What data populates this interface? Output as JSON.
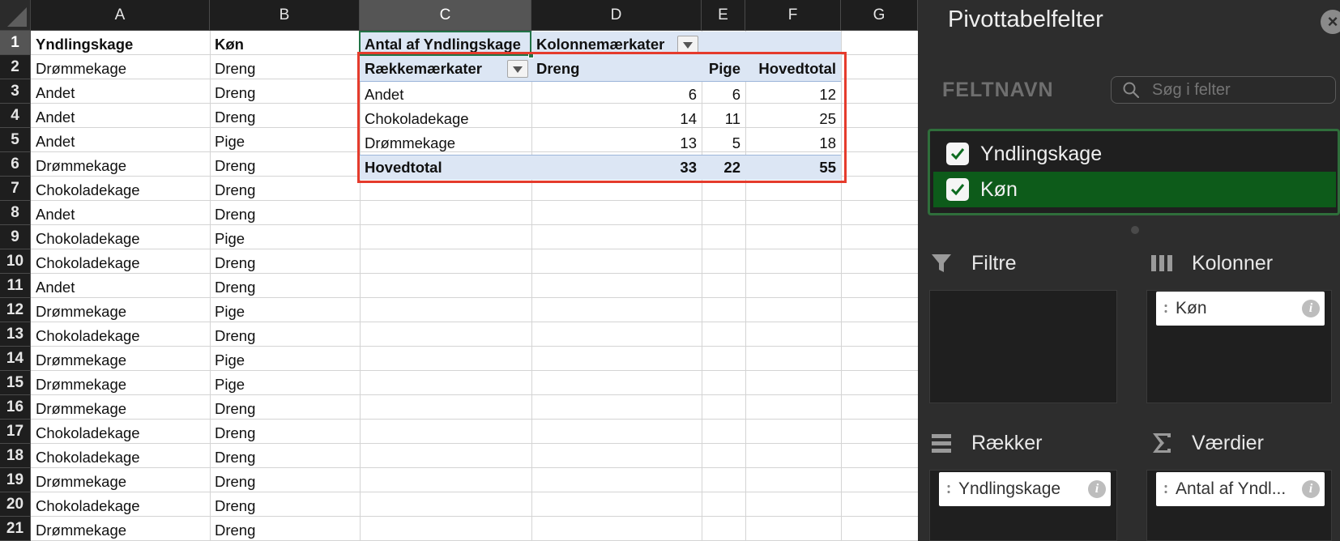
{
  "columns": [
    "A",
    "B",
    "C",
    "D",
    "E",
    "F",
    "G"
  ],
  "rows": [
    "1",
    "2",
    "3",
    "4",
    "5",
    "6",
    "7",
    "8",
    "9",
    "10",
    "11",
    "12",
    "13",
    "14",
    "15",
    "16",
    "17",
    "18",
    "19",
    "20",
    "21"
  ],
  "source": {
    "header_a": "Yndlingskage",
    "header_b": "Køn",
    "data": [
      [
        "Drømmekage",
        "Dreng"
      ],
      [
        "Andet",
        "Dreng"
      ],
      [
        "Andet",
        "Dreng"
      ],
      [
        "Andet",
        "Pige"
      ],
      [
        "Drømmekage",
        "Dreng"
      ],
      [
        "Chokoladekage",
        "Dreng"
      ],
      [
        "Andet",
        "Dreng"
      ],
      [
        "Chokoladekage",
        "Pige"
      ],
      [
        "Chokoladekage",
        "Dreng"
      ],
      [
        "Andet",
        "Dreng"
      ],
      [
        "Drømmekage",
        "Pige"
      ],
      [
        "Chokoladekage",
        "Dreng"
      ],
      [
        "Drømmekage",
        "Pige"
      ],
      [
        "Drømmekage",
        "Pige"
      ],
      [
        "Drømmekage",
        "Dreng"
      ],
      [
        "Chokoladekage",
        "Dreng"
      ],
      [
        "Chokoladekage",
        "Dreng"
      ],
      [
        "Drømmekage",
        "Dreng"
      ],
      [
        "Chokoladekage",
        "Dreng"
      ],
      [
        "Drømmekage",
        "Dreng"
      ]
    ]
  },
  "pivot": {
    "value_label": "Antal af Yndlingskage",
    "column_labels": "Kolonnemærkater",
    "row_labels": "Rækkemærkater",
    "col_dreng": "Dreng",
    "col_pige": "Pige",
    "col_total": "Hovedtotal",
    "rows": [
      {
        "label": "Andet",
        "dreng": "6",
        "pige": "6",
        "total": "12"
      },
      {
        "label": "Chokoladekage",
        "dreng": "14",
        "pige": "11",
        "total": "25"
      },
      {
        "label": "Drømmekage",
        "dreng": "13",
        "pige": "5",
        "total": "18"
      }
    ],
    "total": {
      "label": "Hovedtotal",
      "dreng": "33",
      "pige": "22",
      "total": "55"
    }
  },
  "panel": {
    "title": "Pivottabelfelter",
    "close_icon": "×",
    "field_name_label": "FELTNAVN",
    "search_placeholder": "Søg i felter",
    "fields": [
      {
        "label": "Yndlingskage",
        "checked": true
      },
      {
        "label": "Køn",
        "checked": true
      }
    ],
    "zones": {
      "filters": "Filtre",
      "columns": "Kolonner",
      "rows": "Rækker",
      "values": "Værdier"
    },
    "columns_pill": "Køn",
    "rows_pill": "Yndlingskage",
    "values_pill": "Antal af Yndl...",
    "info_icon": "i"
  },
  "colors": {
    "accent_green": "#217346",
    "pivot_blue": "#dce6f4",
    "highlight_red": "#e53b2c"
  }
}
